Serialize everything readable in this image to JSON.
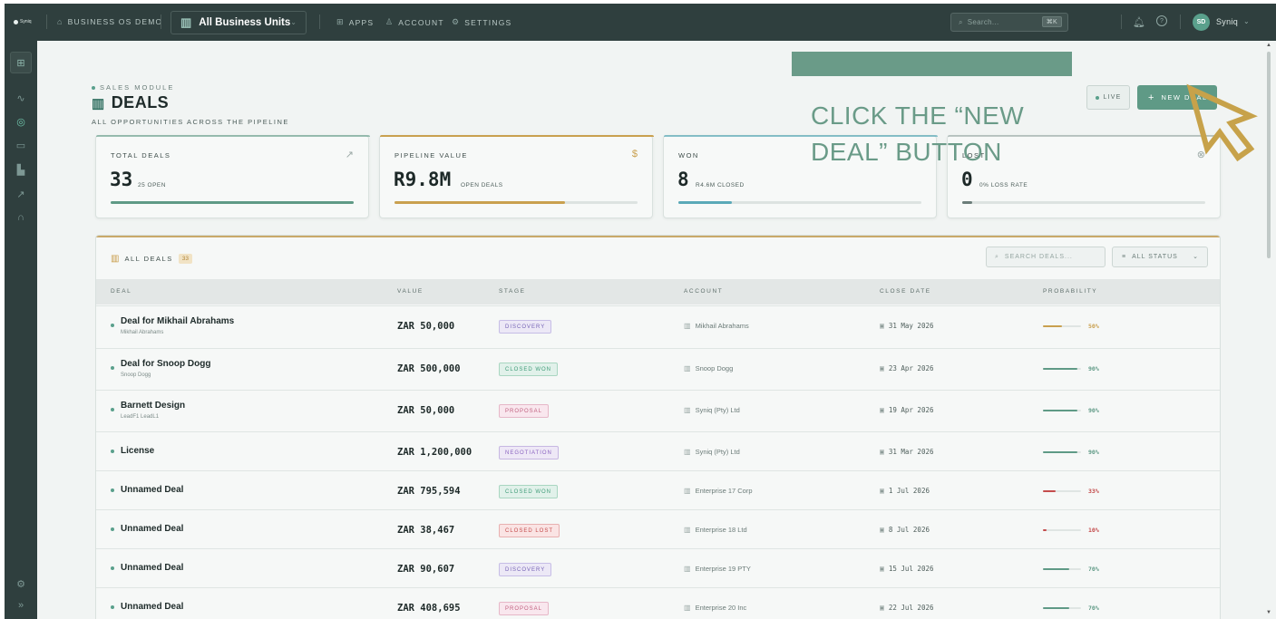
{
  "topbar": {
    "logo_text": "Syniq",
    "workspace": "BUSINESS OS DEMO",
    "units_label": "All Business Units",
    "nav": [
      {
        "label": "APPS",
        "icon": "apps-icon"
      },
      {
        "label": "ACCOUNT",
        "icon": "user-icon"
      },
      {
        "label": "SETTINGS",
        "icon": "gear-icon"
      }
    ],
    "search_placeholder": "Search...",
    "search_shortcut": "⌘K",
    "avatar_initials": "SD",
    "username": "Syniq"
  },
  "sidebar": {
    "items": [
      "grid-icon",
      "activity-icon",
      "target-icon",
      "wallet-icon",
      "chart-icon",
      "trend-icon",
      "headset-icon"
    ],
    "bottom": [
      "gear-icon",
      "expand-icon"
    ]
  },
  "header": {
    "eyebrow": "SALES MODULE",
    "title": "DEALS",
    "subtitle": "ALL OPPORTUNITIES ACROSS THE PIPELINE",
    "live_label": "LIVE",
    "new_deal_label": "NEW DEAL"
  },
  "hint": {
    "text": "CLICK THE “NEW DEAL” BUTTON"
  },
  "stats": [
    {
      "label": "TOTAL DEALS",
      "value": "33",
      "detail": "25 OPEN",
      "progress": 1.0,
      "color": "#5f9a86"
    },
    {
      "label": "PIPELINE VALUE",
      "value": "R9.8M",
      "detail": "OPEN DEALS",
      "progress": 0.7,
      "color": "#c9a04f"
    },
    {
      "label": "WON",
      "value": "8",
      "detail": "R4.6M CLOSED",
      "progress": 0.22,
      "color": "#5aa9b8"
    },
    {
      "label": "LOST",
      "value": "0",
      "detail": "0% LOSS RATE",
      "progress": 0.04,
      "color": "#6b7d79"
    }
  ],
  "deals": {
    "title": "ALL DEALS",
    "count": "33",
    "search_placeholder": "SEARCH DEALS...",
    "status_filter": "ALL STATUS",
    "columns": [
      "DEAL",
      "VALUE",
      "STAGE",
      "ACCOUNT",
      "CLOSE DATE",
      "PROBABILITY"
    ],
    "rows": [
      {
        "name": "Deal for Mikhail Abrahams",
        "sub": "Mikhail Abrahams",
        "value": "ZAR 50,000",
        "stage": "DISCOVERY",
        "stage_kind": "discovery",
        "account": "Mikhail Abrahams",
        "date": "31 May 2026",
        "prob": 50,
        "prob_label": "50%",
        "prob_color": "#c9a04f"
      },
      {
        "name": "Deal for Snoop Dogg",
        "sub": "Snoop Dogg",
        "value": "ZAR 500,000",
        "stage": "CLOSED WON",
        "stage_kind": "won",
        "account": "Snoop Dogg",
        "date": "23 Apr 2026",
        "prob": 90,
        "prob_label": "90%",
        "prob_color": "#5f9a86"
      },
      {
        "name": "Barnett Design",
        "sub": "LeadF1 LeadL1",
        "value": "ZAR 50,000",
        "stage": "PROPOSAL",
        "stage_kind": "proposal",
        "account": "Syniq (Pty) Ltd",
        "date": "19 Apr 2026",
        "prob": 90,
        "prob_label": "90%",
        "prob_color": "#5f9a86"
      },
      {
        "name": "License",
        "sub": "",
        "value": "ZAR 1,200,000",
        "stage": "NEGOTIATION",
        "stage_kind": "negotiation",
        "account": "Syniq (Pty) Ltd",
        "date": "31 Mar 2026",
        "prob": 90,
        "prob_label": "90%",
        "prob_color": "#5f9a86"
      },
      {
        "name": "Unnamed Deal",
        "sub": "",
        "value": "ZAR 795,594",
        "stage": "CLOSED WON",
        "stage_kind": "won",
        "account": "Enterprise 17 Corp",
        "date": "1 Jul 2026",
        "prob": 33,
        "prob_label": "33%",
        "prob_color": "#c44c4c"
      },
      {
        "name": "Unnamed Deal",
        "sub": "",
        "value": "ZAR 38,467",
        "stage": "CLOSED LOST",
        "stage_kind": "lost",
        "account": "Enterprise 18 Ltd",
        "date": "8 Jul 2026",
        "prob": 10,
        "prob_label": "10%",
        "prob_color": "#c44c4c"
      },
      {
        "name": "Unnamed Deal",
        "sub": "",
        "value": "ZAR 90,607",
        "stage": "DISCOVERY",
        "stage_kind": "discovery",
        "account": "Enterprise 19 PTY",
        "date": "15 Jul 2026",
        "prob": 70,
        "prob_label": "70%",
        "prob_color": "#5f9a86"
      },
      {
        "name": "Unnamed Deal",
        "sub": "",
        "value": "ZAR 408,695",
        "stage": "PROPOSAL",
        "stage_kind": "proposal",
        "account": "Enterprise 20 Inc",
        "date": "22 Jul 2026",
        "prob": 70,
        "prob_label": "70%",
        "prob_color": "#5f9a86"
      }
    ]
  },
  "colors": {
    "accent": "#5f9a86",
    "gold": "#c9a04f",
    "hint": "#6a9b88",
    "pointer": "#c7a24a"
  }
}
